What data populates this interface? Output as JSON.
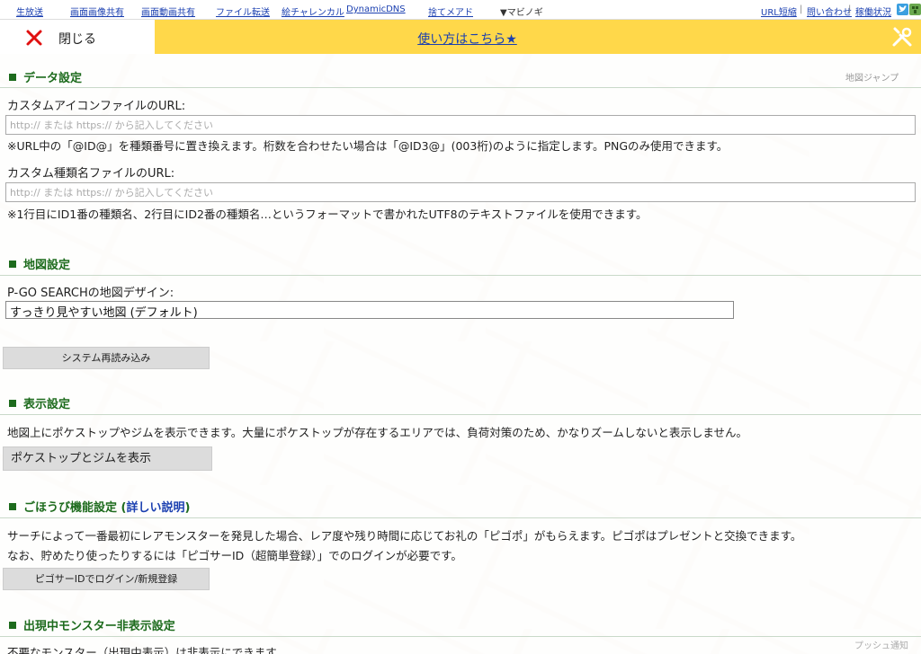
{
  "topbar": {
    "links": [
      "生放送",
      "画面画像共有",
      "画面動画共有",
      "ファイル転送",
      "絵チャレンカル",
      "DynamicDNS",
      "捨てメアド"
    ],
    "dropdown": "▼マビノギ",
    "right_links": [
      "URL短縮",
      "問い合わせ",
      "稼働状況"
    ],
    "separator": "|"
  },
  "closebar": {
    "close_label": "閉じる"
  },
  "helpbar": {
    "help_link": "使い方はこちら★"
  },
  "map": {
    "jump_label": "地図ジャンプ",
    "push_label": "プッシュ通知"
  },
  "data_settings": {
    "title": "データ設定",
    "icon_url_label": "カスタムアイコンファイルのURL:",
    "icon_url_placeholder": "http:// または https:// から記入してください",
    "icon_url_note": "※URL中の「@ID@」を種類番号に置き換えます。桁数を合わせたい場合は「@ID3@」(003桁)のように指定します。PNGのみ使用できます。",
    "name_url_label": "カスタム種類名ファイルのURL:",
    "name_url_placeholder": "http:// または https:// から記入してください",
    "name_url_note": "※1行目にID1番の種類名、2行目にID2番の種類名…というフォーマットで書かれたUTF8のテキストファイルを使用できます。"
  },
  "map_settings": {
    "title": "地図設定",
    "design_label": "P-GO SEARCHの地図デザイン:",
    "design_value": "すっきり見やすい地図 (デフォルト)",
    "reload_button": "システム再読み込み"
  },
  "display_settings": {
    "title": "表示設定",
    "description": "地図上にポケストップやジムを表示できます。大量にポケストップが存在するエリアでは、負荷対策のため、かなりズームしないと表示しません。",
    "show_button": "ポケストップとジムを表示"
  },
  "reward_settings": {
    "title": "ごほうび機能設定 (",
    "detail_link": "詳しい説明",
    "title_close": ")",
    "line1": "サーチによって一番最初にレアモンスターを発見した場合、レア度や残り時間に応じてお礼の「ピゴポ」がもらえます。ピゴポはプレゼントと交換できます。",
    "line2": "なお、貯めたり使ったりするには「ピゴサーID（超簡単登録）」でのログインが必要です。",
    "login_button": "ピゴサーIDでログイン/新規登録"
  },
  "hide_settings": {
    "title": "出現中モンスター非表示設定",
    "description": "不要なモンスター（出現中表示）は非表示にできます。"
  },
  "colors": {
    "accent_yellow": "#ffd84a",
    "section_green": "#1d6b1d",
    "link_blue": "#1a3fb0",
    "close_red": "#e01010"
  }
}
